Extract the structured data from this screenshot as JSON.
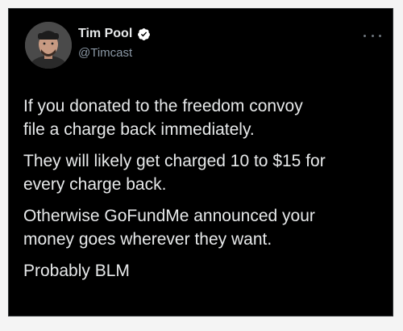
{
  "tweet": {
    "author": {
      "display_name": "Tim Pool",
      "handle": "@Timcast",
      "verified": true,
      "avatar_icon": "profile-photo"
    },
    "more_icon": "ellipsis-icon",
    "paragraphs": [
      "If you donated to the freedom convoy\nfile a charge back immediately.",
      "They will likely get charged 10 to $15 for\nevery charge back.",
      "Otherwise GoFundMe announced your\nmoney goes wherever they want.",
      "Probably BLM"
    ]
  },
  "colors": {
    "background": "#000000",
    "text": "#e7e9ea",
    "secondary_text": "#8b98a5",
    "verified_badge": "#ffffff"
  }
}
